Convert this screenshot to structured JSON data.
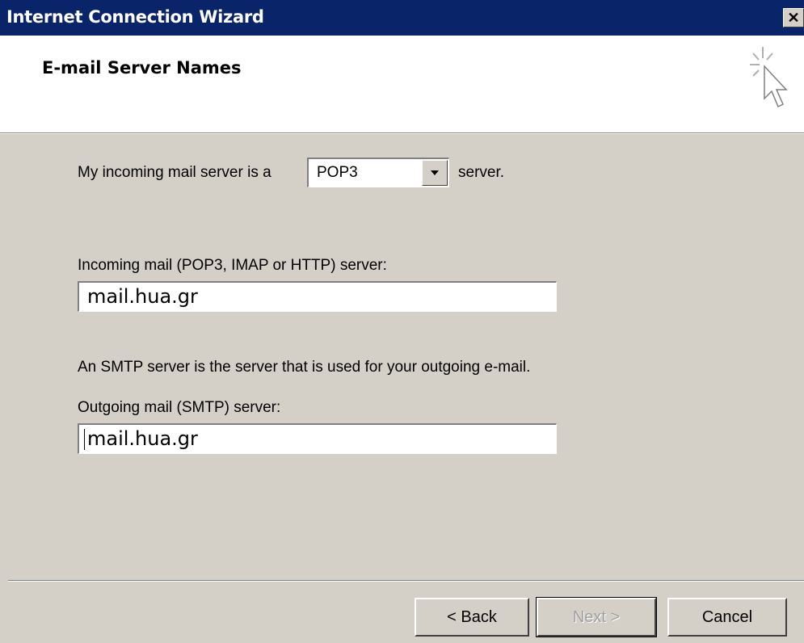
{
  "window": {
    "title": "Internet Connection Wizard",
    "close_label": "✕"
  },
  "header": {
    "title": "E-mail Server Names"
  },
  "form": {
    "server_type_prefix": "My incoming mail server is a",
    "server_type_value": "POP3",
    "server_type_suffix": "server.",
    "incoming_label": "Incoming mail (POP3, IMAP or HTTP) server:",
    "incoming_value": "mail.hua.gr",
    "smtp_note": "An SMTP server is the server that is used for your outgoing e-mail.",
    "outgoing_label": "Outgoing mail (SMTP) server:",
    "outgoing_value": "mail.hua.gr"
  },
  "buttons": {
    "back": "< Back",
    "next": "Next >",
    "cancel": "Cancel"
  }
}
